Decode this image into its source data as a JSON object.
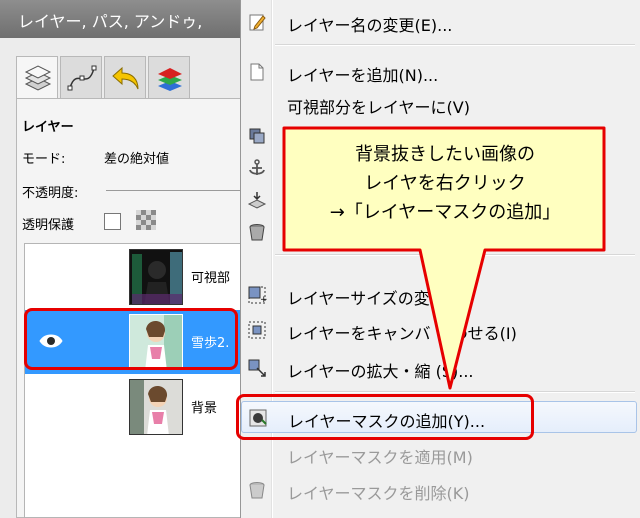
{
  "window": {
    "title": "レイヤー, パス, アンドゥ,"
  },
  "tabs": [
    {
      "icon": "layers-icon"
    },
    {
      "icon": "paths-icon"
    },
    {
      "icon": "undo-icon"
    },
    {
      "icon": "channels-icon"
    }
  ],
  "layers_panel": {
    "heading": "レイヤー",
    "mode_label": "モード:",
    "mode_value": "差の絶対値",
    "opacity_label": "不透明度:",
    "lock_label": "透明保護",
    "layers": [
      {
        "name": "可視部",
        "selected": false
      },
      {
        "name": "雪歩2.",
        "selected": true,
        "visible_icon": "eye-icon"
      },
      {
        "name": "背景",
        "selected": false
      }
    ]
  },
  "context_menu": {
    "items": [
      {
        "label": "レイヤー名の変更(E)...",
        "icon": "edit-icon",
        "enabled": true
      },
      {
        "label": "レイヤーを追加(N)...",
        "icon": "new-page-icon",
        "enabled": true
      },
      {
        "label": "可視部分をレイヤーに(V)",
        "icon": "",
        "enabled": true
      },
      {
        "label": "",
        "icon": "duplicate-icon",
        "enabled": true
      },
      {
        "label": "",
        "icon": "anchor-icon",
        "enabled": true
      },
      {
        "label": "",
        "icon": "merge-down-icon",
        "enabled": true
      },
      {
        "label": "",
        "icon": "delete-icon",
        "enabled": true
      },
      {
        "label": "レイヤーサイズの変更",
        "icon": "layer-size-icon",
        "enabled": true
      },
      {
        "label": "レイヤーをキャンバ   合わせる(I)",
        "icon": "fit-canvas-icon",
        "enabled": true
      },
      {
        "label": "レイヤーの拡大・縮   (S)...",
        "icon": "scale-icon",
        "enabled": true
      },
      {
        "label": "レイヤーマスクの追加(Y)...",
        "icon": "add-mask-icon",
        "enabled": true,
        "hovered": true
      },
      {
        "label": "レイヤーマスクを適用(M)",
        "icon": "",
        "enabled": false
      },
      {
        "label": "レイヤーマスクを削除(K)",
        "icon": "delete-icon",
        "enabled": false
      }
    ]
  },
  "callout": {
    "lines": [
      "背景抜きしたい画像の",
      "レイヤを右クリック",
      "→「レイヤーマスクの追加」"
    ],
    "fill": "#ffffc0",
    "border": "#e60000"
  },
  "colors": {
    "selection": "#3399ff",
    "highlight": "#e60000"
  }
}
